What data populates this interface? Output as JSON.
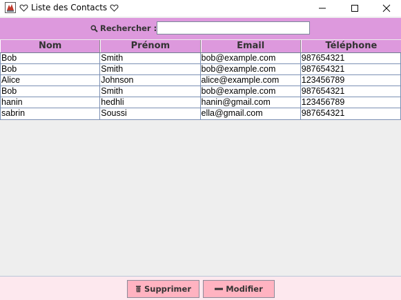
{
  "window": {
    "title": "Liste des Contacts",
    "colors": {
      "accent": "#dd99dd",
      "button": "#ffb3c1",
      "bottom_bar": "#fde8ee",
      "background": "#eeeeee"
    }
  },
  "search": {
    "label": "Rechercher :",
    "value": "",
    "placeholder": "",
    "icon": "search-icon"
  },
  "table": {
    "columns": [
      "Nom",
      "Prénom",
      "Email",
      "Téléphone"
    ],
    "rows": [
      [
        "Bob",
        "Smith",
        "bob@example.com",
        "987654321"
      ],
      [
        "Bob",
        "Smith",
        "bob@example.com",
        "987654321"
      ],
      [
        "Alice",
        "Johnson",
        "alice@example.com",
        "123456789"
      ],
      [
        "Bob",
        "Smith",
        "bob@example.com",
        "987654321"
      ],
      [
        "hanin",
        "hedhli",
        "hanin@gmail.com",
        "123456789"
      ],
      [
        "sabrin",
        "Soussi",
        "ella@gmail.com",
        "987654321"
      ]
    ]
  },
  "actions": {
    "delete_label": "Supprimer",
    "delete_icon": "trash-icon",
    "edit_label": "Modifier",
    "edit_icon": "minus-icon"
  }
}
